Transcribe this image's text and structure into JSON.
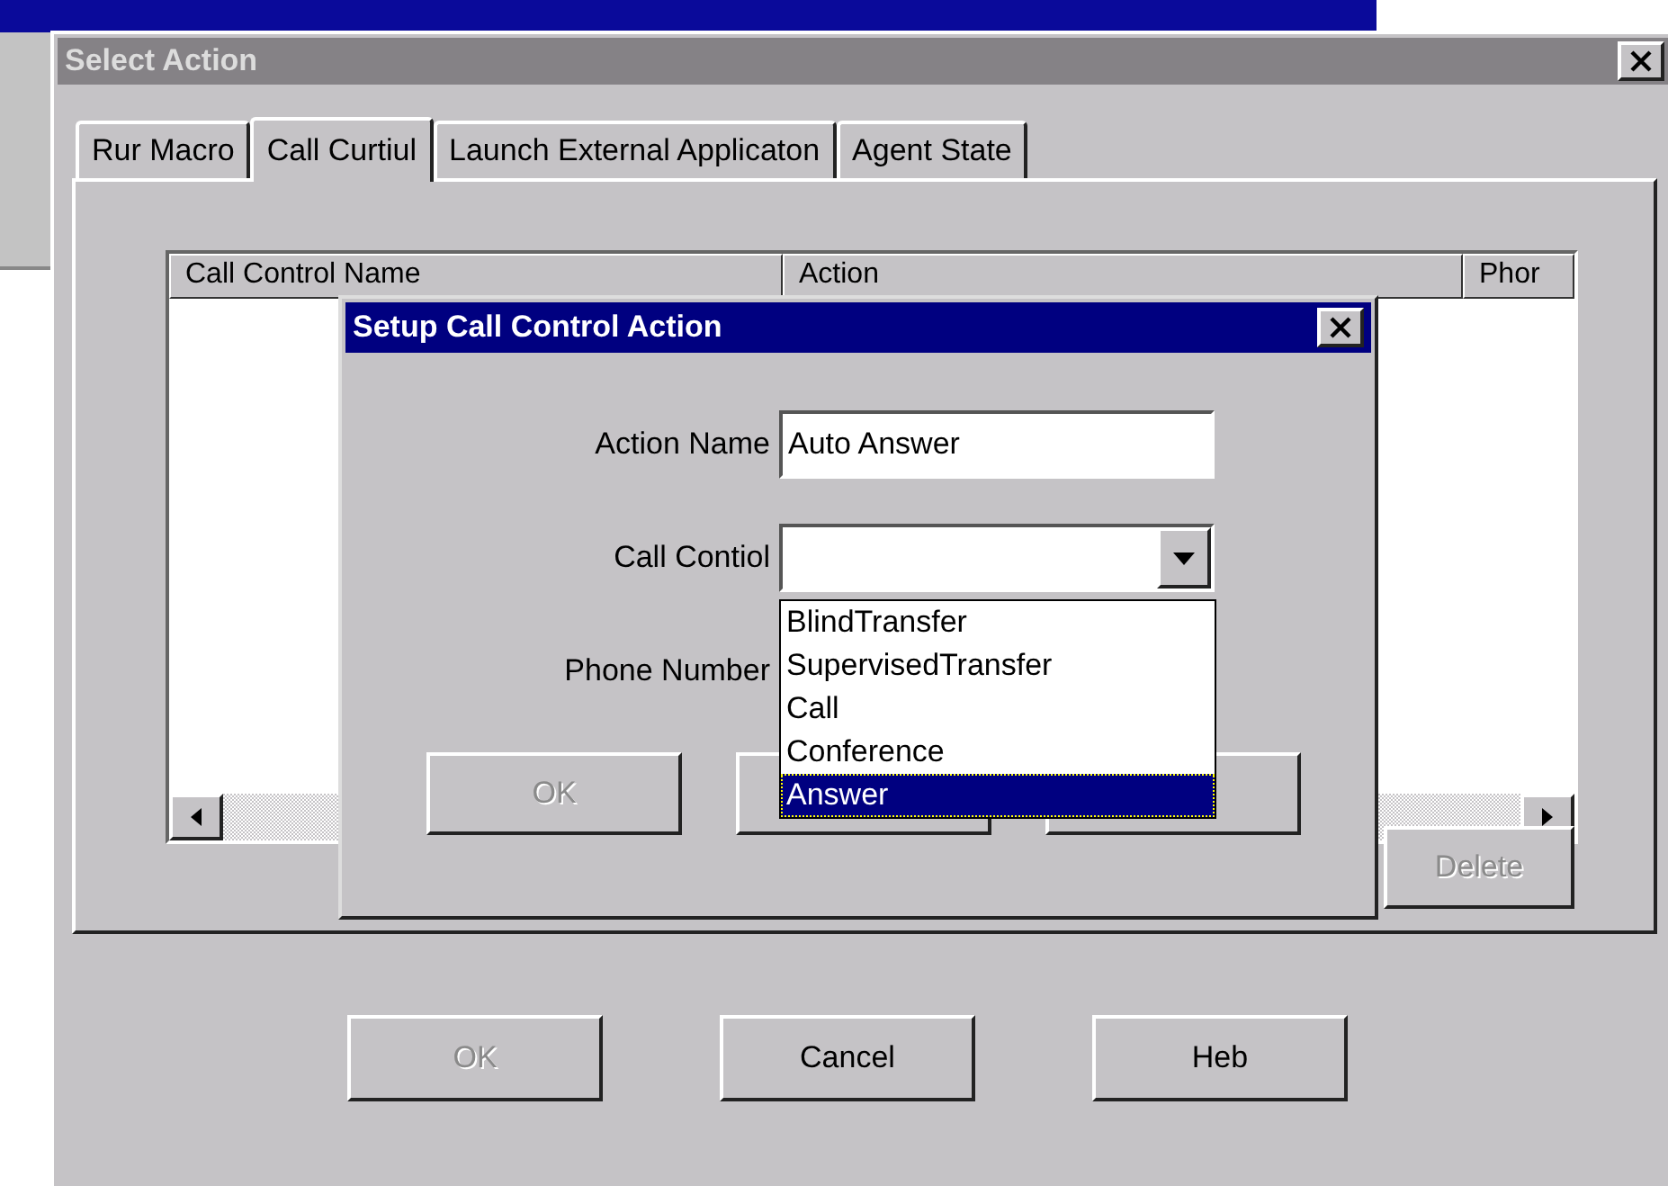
{
  "window": {
    "title": "Select Action"
  },
  "tabs": [
    {
      "label": "Rur Macro",
      "selected": false
    },
    {
      "label": "Call Curtiul",
      "selected": true
    },
    {
      "label": "Launch External Applicaton",
      "selected": false
    },
    {
      "label": "Agent State",
      "selected": false
    }
  ],
  "table": {
    "columns": [
      "Call Control Name",
      "Action",
      "Phor"
    ]
  },
  "delete_button": {
    "label": "Delete",
    "disabled": true
  },
  "buttons": [
    {
      "label": "OK",
      "disabled": true
    },
    {
      "label": "Cancel",
      "disabled": false
    },
    {
      "label": "Heb",
      "disabled": false
    }
  ],
  "dialog": {
    "title": "Setup Call Control Action",
    "fields": [
      {
        "label": "Action Name",
        "value": "Auto Answer",
        "kind": "text"
      },
      {
        "label": "Call Contiol",
        "kind": "combo"
      },
      {
        "label": "Phone Number",
        "kind": "text"
      }
    ],
    "dropdown": [
      {
        "label": "BlindTransfer",
        "selected": false
      },
      {
        "label": "SupervisedTransfer",
        "selected": false
      },
      {
        "label": "Call",
        "selected": false
      },
      {
        "label": "Conference",
        "selected": false
      },
      {
        "label": "Answer",
        "selected": true
      }
    ],
    "buttons": [
      {
        "label": "OK",
        "disabled": true
      }
    ]
  }
}
